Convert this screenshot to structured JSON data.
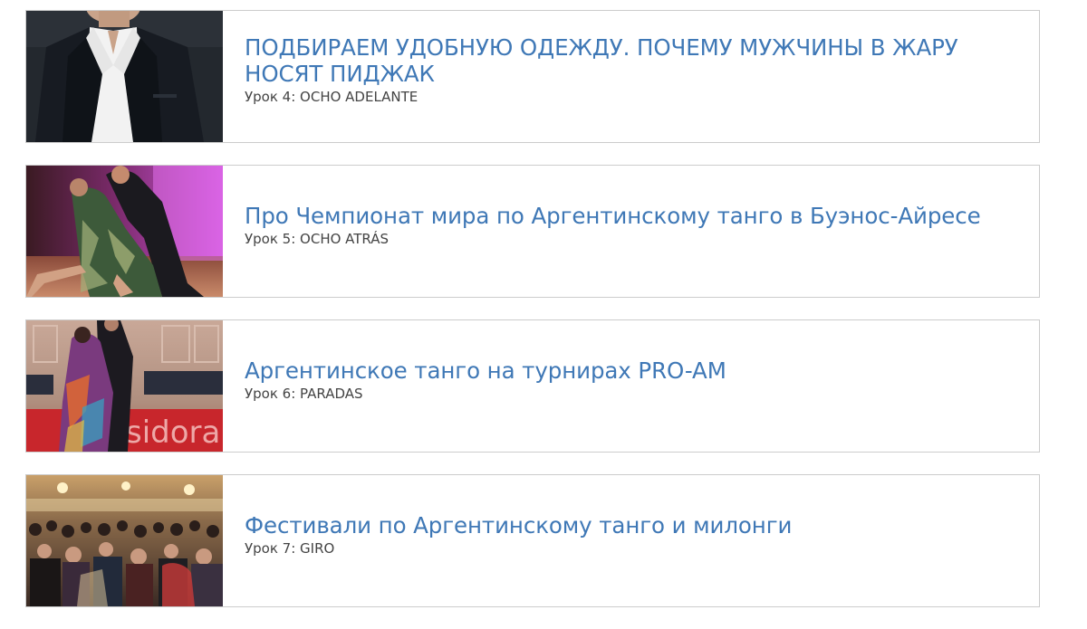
{
  "lessons": [
    {
      "title": "ПОДБИРАЕМ УДОБНУЮ ОДЕЖДУ. ПОЧЕМУ МУЖЧИНЫ В ЖАРУ НОСЯТ ПИДЖАК",
      "subtitle": "Урок 4: OCHO ADELANTE",
      "image": "man-in-suit-photo"
    },
    {
      "title": "Про Чемпионат мира по Аргентинскому танго в Буэнос-Айресе",
      "subtitle": "Урок 5: OCHO ATRÁS",
      "image": "tango-couple-photo"
    },
    {
      "title": "Аргентинское танго на турнирах PRO-AM",
      "subtitle": "Урок 6: PARADAS",
      "image": "proam-dance-photo"
    },
    {
      "title": "Фестивали по Аргентинскому танго и милонги",
      "subtitle": "Урок 7: GIRO",
      "image": "milonga-crowd-photo"
    }
  ],
  "colors": {
    "title": "#3f78b6",
    "subtitle": "#444444",
    "border": "#cccccc"
  }
}
